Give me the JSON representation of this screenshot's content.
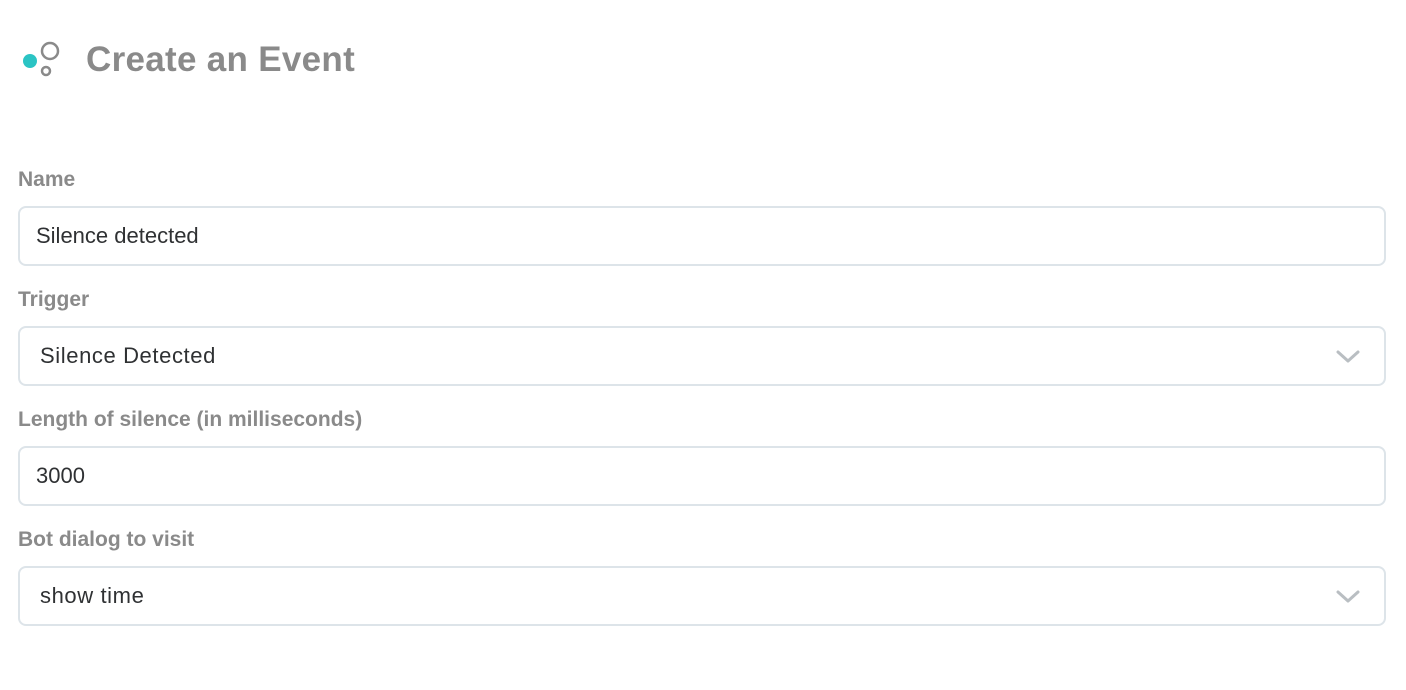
{
  "header": {
    "title": "Create an Event",
    "logo_icon": "bubbles-logo-icon",
    "accent_color": "#2bc4c4"
  },
  "form": {
    "name": {
      "label": "Name",
      "value": "Silence detected"
    },
    "trigger": {
      "label": "Trigger",
      "selected": "Silence Detected",
      "icon": "chevron-down-icon"
    },
    "silence_length": {
      "label": "Length of silence (in milliseconds)",
      "value": "3000"
    },
    "bot_dialog": {
      "label": "Bot dialog to visit",
      "selected": "show time",
      "icon": "chevron-down-icon"
    }
  }
}
